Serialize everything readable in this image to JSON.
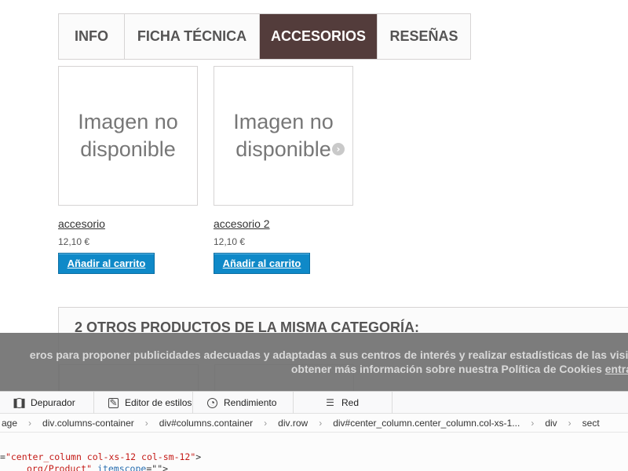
{
  "tabs": [
    {
      "label": "INFO",
      "active": false
    },
    {
      "label": "FICHA TÉCNICA",
      "active": false
    },
    {
      "label": "ACCESORIOS",
      "active": true
    },
    {
      "label": "RESEÑAS",
      "active": false
    }
  ],
  "products": [
    {
      "image_text": "Imagen no disponible",
      "name": "accesorio",
      "price": "12,10 €",
      "button": "Añadir al carrito"
    },
    {
      "image_text": "Imagen no disponible",
      "name": "accesorio 2",
      "price": "12,10 €",
      "button": "Añadir al carrito"
    }
  ],
  "section": {
    "title": "2 OTROS PRODUCTOS DE LA MISMA CATEGORÍA:"
  },
  "cookie_banner": {
    "line1": "eros para proponer publicidades adecuadas y adaptadas a sus centros de interés y realizar estadísticas de las visit",
    "line2_text": "obtener más información sobre nuestra Política de Cookies ",
    "line2_link": "entra"
  },
  "devtools": {
    "tabs": [
      {
        "label": "Depurador",
        "icon": "pause-icon"
      },
      {
        "label": "Editor de estilos",
        "icon": "pencil-icon"
      },
      {
        "label": "Rendimiento",
        "icon": "gauge-icon"
      },
      {
        "label": "Red",
        "icon": "network-icon"
      }
    ],
    "breadcrumbs": [
      {
        "tag": "",
        "rest": "age"
      },
      {
        "tag": "div",
        "rest": ".columns-container"
      },
      {
        "tag": "div",
        "rest": "#columns.container"
      },
      {
        "tag": "div",
        "rest": ".row"
      },
      {
        "tag": "div",
        "rest": "#center_column.center_column.col-xs-1..."
      },
      {
        "tag": "",
        "rest": "div"
      },
      {
        "tag": "",
        "rest": "sect"
      }
    ],
    "code_line1_prefix": "=",
    "code_line1_value": "\"center_column col-xs-12 col-sm-12\"",
    "code_line1_suffix": ">",
    "code_line2_value": "org/Product\"",
    "code_line2_attr": " itemscope",
    "code_line2_suffix": "=\"\">"
  },
  "colors": {
    "active_tab": "#533c3b",
    "cart_button": "#0f89c8"
  }
}
